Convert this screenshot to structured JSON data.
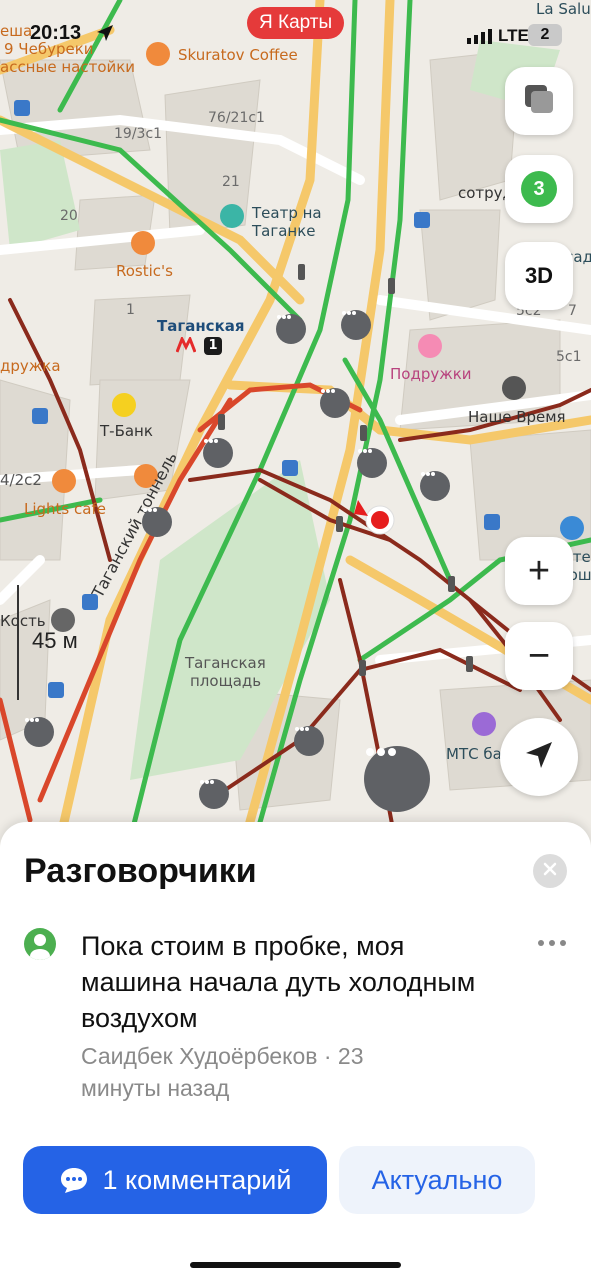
{
  "status_bar": {
    "time": "20:13",
    "network": "LTE",
    "battery": "2"
  },
  "app_badge": {
    "label": "Я Карты"
  },
  "map": {
    "poi": {
      "skuratov": "Skuratov Coffee",
      "teatr": "Театр на Таганке",
      "rostics": "Rostic's",
      "metro": "Таганская",
      "metro_line": "1",
      "tbank": "Т-Банк",
      "lights": "Lights cafe",
      "podruzhki": "Подружки",
      "nashe_vremya": "Наше Время",
      "mts": "МТС банк",
      "kost": "Кость",
      "cheburek": "9 Чебуреки",
      "nastoyki": "ассные настойки",
      "resha": "еша",
      "druzhka": "дружка",
      "c2": "4/2с2",
      "la_salute": "La Salute",
      "sotrud": "сотруд",
      "usadba": "Усадьба",
      "cheste": "Честе",
      "klushi": "Клюшн",
      "tunnel": "Таганский тоннель",
      "square_1": "Таганская",
      "square_2": "площадь"
    },
    "building_numbers": [
      "19/3с1",
      "76/21с1",
      "21",
      "20",
      "1",
      "5с2",
      "7",
      "5с1"
    ],
    "scale_label": "45 м",
    "traffic_score": "3"
  },
  "controls": {
    "layers_icon": "layers-icon",
    "three_d": "3D",
    "zoom_in": "+",
    "zoom_out": "−"
  },
  "sheet": {
    "title": "Разговорчики",
    "message": "Пока стоим  в пробке, моя машина начала дуть холодным воздухом",
    "author_line": "Саидбек Худоёрбеков · 23 минуты назад",
    "comments_button": "1 комментарий",
    "relevant_button": "Актуально"
  },
  "colors": {
    "accent": "#2563e6",
    "traffic_green": "#3dba4e",
    "traffic_red": "#d9472b",
    "traffic_dark": "#8a2a1c",
    "road_yellow": "#f5c86a"
  }
}
